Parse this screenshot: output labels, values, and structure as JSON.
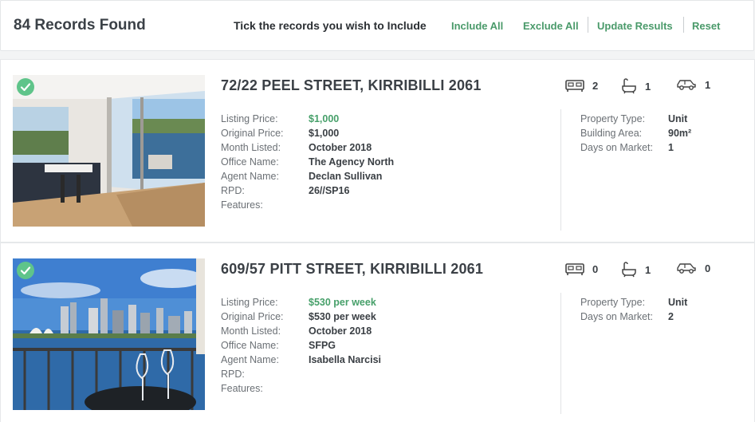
{
  "header": {
    "records_found": "84 Records Found",
    "tick_label": "Tick the records you wish to Include",
    "include_all": "Include All",
    "exclude_all": "Exclude All",
    "update_results": "Update Results",
    "reset": "Reset"
  },
  "colors": {
    "accent_green": "#47a06a",
    "check_green": "#5fc48a"
  },
  "records": [
    {
      "selected": true,
      "address": "72/22 PEEL STREET, KIRRIBILLI 2061",
      "beds": "2",
      "baths": "1",
      "cars": "1",
      "fields": {
        "listing_price_label": "Listing Price:",
        "listing_price": "$1,000",
        "original_price_label": "Original Price:",
        "original_price": "$1,000",
        "month_listed_label": "Month Listed:",
        "month_listed": "October 2018",
        "office_name_label": "Office Name:",
        "office_name": "The Agency North",
        "agent_name_label": "Agent Name:",
        "agent_name": "Declan Sullivan",
        "rpd_label": "RPD:",
        "rpd": "26//SP16",
        "features_label": "Features:",
        "features": ""
      },
      "props": {
        "property_type_label": "Property Type:",
        "property_type": "Unit",
        "building_area_label": "Building Area:",
        "building_area": "90m²",
        "days_on_market_label": "Days on Market:",
        "days_on_market": "1"
      }
    },
    {
      "selected": true,
      "address": "609/57 PITT STREET, KIRRIBILLI 2061",
      "beds": "0",
      "baths": "1",
      "cars": "0",
      "fields": {
        "listing_price_label": "Listing Price:",
        "listing_price": "$530 per week",
        "original_price_label": "Original Price:",
        "original_price": "$530 per week",
        "month_listed_label": "Month Listed:",
        "month_listed": "October 2018",
        "office_name_label": "Office Name:",
        "office_name": "SFPG",
        "agent_name_label": "Agent Name:",
        "agent_name": "Isabella Narcisi",
        "rpd_label": "RPD:",
        "rpd": "",
        "features_label": "Features:",
        "features": ""
      },
      "props": {
        "property_type_label": "Property Type:",
        "property_type": "Unit",
        "days_on_market_label": "Days on Market:",
        "days_on_market": "2"
      }
    }
  ]
}
